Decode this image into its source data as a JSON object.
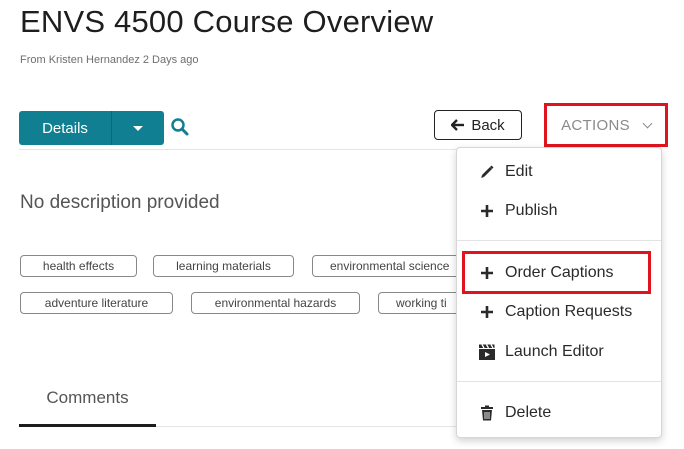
{
  "header": {
    "title": "ENVS 4500 Course Overview",
    "subtitle": "From Kristen Hernandez 2 Days ago"
  },
  "toolbar": {
    "details_label": "Details",
    "back_label": "Back",
    "actions_label": "ACTIONS"
  },
  "description": "No description provided",
  "tags": [
    "health effects",
    "learning materials",
    "environmental science",
    "adventure literature",
    "environmental hazards",
    "working ti"
  ],
  "tabs": {
    "comments_label": "Comments"
  },
  "actions_menu": {
    "items": [
      {
        "label": "Edit",
        "icon": "pencil-icon"
      },
      {
        "label": "Publish",
        "icon": "plus-icon"
      },
      {
        "label": "Order Captions",
        "icon": "plus-icon"
      },
      {
        "label": "Caption Requests",
        "icon": "plus-icon"
      },
      {
        "label": "Launch Editor",
        "icon": "clapperboard-icon"
      },
      {
        "label": "Delete",
        "icon": "trash-icon"
      }
    ]
  },
  "colors": {
    "primary": "#0f7f91",
    "highlight": "#e0141e",
    "text": "#333333"
  }
}
